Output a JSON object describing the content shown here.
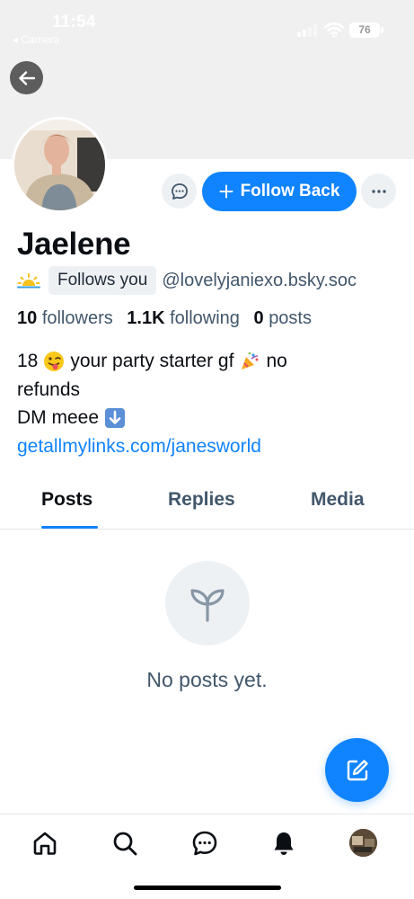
{
  "status_bar": {
    "time": "11:54",
    "back_app": "◂ Camera",
    "battery": "76"
  },
  "profile": {
    "display_name": "Jaelene",
    "sun_emoji": "sun-emoji",
    "follows_you": "Follows you",
    "handle": "@lovelyjaniexo.bsky.soc",
    "follow_button": "Follow Back",
    "stats": {
      "followers_count": "10",
      "followers_label": "followers",
      "following_count": "1.1K",
      "following_label": "following",
      "posts_count": "0",
      "posts_label": "posts"
    },
    "bio": {
      "line1_a": "18",
      "line1_b": "your party starter gf",
      "line1_c": "no",
      "line2": "refunds",
      "line3": "DM meee",
      "link": "getallmylinks.com/janesworld"
    }
  },
  "tabs": [
    {
      "label": "Posts",
      "active": true
    },
    {
      "label": "Replies",
      "active": false
    },
    {
      "label": "Media",
      "active": false
    }
  ],
  "empty_state": {
    "text": "No posts yet."
  },
  "colors": {
    "accent": "#1083fe",
    "muted_text": "#42576c",
    "chip_bg": "#eef1f4"
  },
  "icons": [
    "back-arrow-icon",
    "message-icon",
    "more-icon",
    "plus-icon",
    "sprout-icon",
    "compose-icon",
    "home-icon",
    "search-icon",
    "chat-icon",
    "bell-icon"
  ]
}
